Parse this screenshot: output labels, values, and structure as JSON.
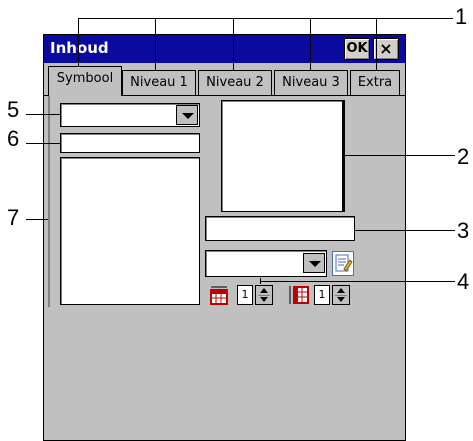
{
  "window": {
    "title": "Inhoud",
    "ok_label": "OK",
    "close_label": "×"
  },
  "tabs": [
    {
      "label": "Symbool",
      "active": true
    },
    {
      "label": "Niveau 1",
      "active": false
    },
    {
      "label": "Niveau 2",
      "active": false
    },
    {
      "label": "Niveau 3",
      "active": false
    },
    {
      "label": "Extra",
      "active": false
    }
  ],
  "controls": {
    "spinner_columns_value": "1",
    "spinner_rows_value": "1"
  },
  "callouts": {
    "c1": "1",
    "c2": "2",
    "c3": "3",
    "c4": "4",
    "c5": "5",
    "c6": "6",
    "c7": "7"
  },
  "colors": {
    "titlebar": "#0a0a9e",
    "window_bg": "#c0c0c0",
    "field_bg": "#ffffff"
  },
  "icons": [
    "edit-icon",
    "table-columns-icon",
    "table-rows-icon",
    "chevron-down-icon",
    "close-icon"
  ]
}
